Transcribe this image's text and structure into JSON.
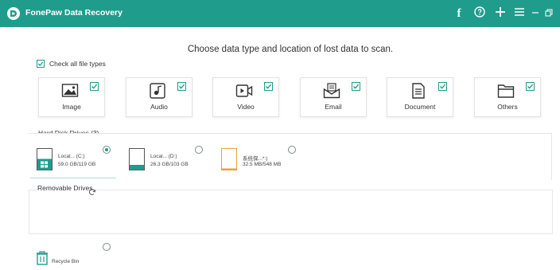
{
  "app": {
    "title": "FonePaw Data Recovery"
  },
  "titlebar": {
    "buttons": [
      {
        "name": "facebook-button",
        "icon": "facebook-icon"
      },
      {
        "name": "feedback-button",
        "icon": "feedback-icon"
      },
      {
        "name": "add-button",
        "icon": "plus-icon"
      },
      {
        "name": "menu-button",
        "icon": "menu-icon"
      },
      {
        "name": "minimize-button",
        "icon": "minimize-icon"
      },
      {
        "name": "restore-button",
        "icon": "restore-icon"
      }
    ]
  },
  "main": {
    "headline": "Choose data type and location of lost data to scan.",
    "check_all_label": "Check all file types",
    "check_all_checked": true,
    "file_types": [
      {
        "label": "Image",
        "icon": "image-icon",
        "checked": true
      },
      {
        "label": "Audio",
        "icon": "audio-icon",
        "checked": true
      },
      {
        "label": "Video",
        "icon": "video-icon",
        "checked": true
      },
      {
        "label": "Email",
        "icon": "email-icon",
        "checked": true
      },
      {
        "label": "Document",
        "icon": "document-icon",
        "checked": true
      },
      {
        "label": "Others",
        "icon": "folder-icon",
        "checked": true
      }
    ]
  },
  "hard_disk": {
    "label": "Hard Disk Drives (3)",
    "drives": [
      {
        "name": "Local... (C:)",
        "size": "59.0 GB/119 GB",
        "icon": "windows-drive-icon",
        "selected": true,
        "fill": 0.5
      },
      {
        "name": "Local... (D:)",
        "size": "26.3 GB/103 GB",
        "icon": "drive-icon",
        "selected": false,
        "fill": 0.26
      },
      {
        "name": "系统保...*:)",
        "size": "32.5 MB/548 MB",
        "icon": "system-drive-icon",
        "selected": false,
        "fill": 0.06
      }
    ]
  },
  "removable": {
    "label": "Removable Drives",
    "refresh_icon": "refresh-icon"
  },
  "recycle_bin": {
    "label": "Recycle Bin",
    "icon": "recycle-bin-icon",
    "selected": false
  },
  "colors": {
    "accent": "#1f9c8c",
    "system_drive": "#e8a040"
  }
}
